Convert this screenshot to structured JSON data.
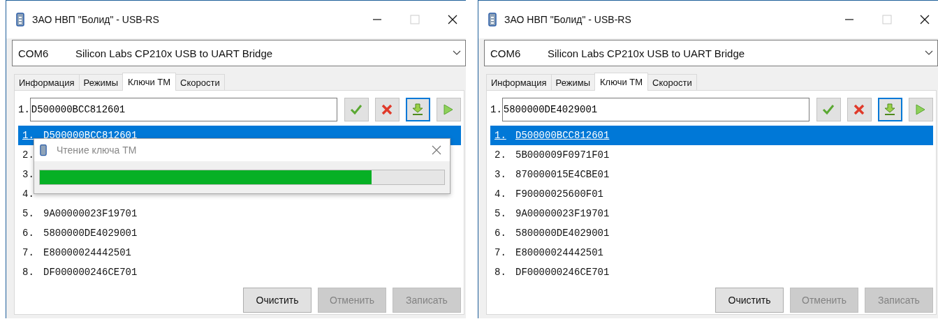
{
  "windows": [
    {
      "title": "ЗАО НВП \"Болид\" - USB-RS",
      "port": {
        "com": "COM6",
        "name": "Silicon Labs CP210x USB to UART Bridge"
      },
      "tabs": [
        {
          "label": "Информация",
          "selected": false
        },
        {
          "label": "Режимы",
          "selected": false
        },
        {
          "label": "Ключи ТМ",
          "selected": true
        },
        {
          "label": "Скорости",
          "selected": false
        }
      ],
      "key_input": {
        "prefix": "1.",
        "value": "D500000BCC812601"
      },
      "tools": [
        {
          "kind": "accept",
          "focused": false
        },
        {
          "kind": "delete",
          "focused": false
        },
        {
          "kind": "read",
          "focused": true
        },
        {
          "kind": "run",
          "focused": false
        }
      ],
      "keys": [
        {
          "number": "1.",
          "code": "D500000BCC812601",
          "selected": true
        },
        {
          "number": "2.",
          "selected": false
        },
        {
          "number": "3.",
          "selected": false
        },
        {
          "number": "4.",
          "selected": false
        },
        {
          "number": "5.",
          "code": "9A00000023F19701",
          "selected": false
        },
        {
          "number": "6.",
          "code": "5800000DE4029001",
          "selected": false
        },
        {
          "number": "7.",
          "code": "E80000024442501",
          "selected": false
        },
        {
          "number": "8.",
          "code": "DF000000246CE701",
          "selected": false
        }
      ],
      "buttons": [
        {
          "label": "Очистить",
          "disabled": false
        },
        {
          "label": "Отменить",
          "disabled": true
        },
        {
          "label": "Записать",
          "disabled": true
        }
      ],
      "dialog": {
        "title": "Чтение ключа ТМ",
        "level": 0.82
      }
    },
    {
      "title": "ЗАО НВП \"Болид\" - USB-RS",
      "port": {
        "com": "COM6",
        "name": "Silicon Labs CP210x USB to UART Bridge"
      },
      "tabs": [
        {
          "label": "Информация",
          "selected": false
        },
        {
          "label": "Режимы",
          "selected": false
        },
        {
          "label": "Ключи ТМ",
          "selected": true
        },
        {
          "label": "Скорости",
          "selected": false
        }
      ],
      "key_input": {
        "prefix": "1.",
        "value": "5800000DE4029001"
      },
      "tools": [
        {
          "kind": "accept",
          "focused": false
        },
        {
          "kind": "delete",
          "focused": false
        },
        {
          "kind": "read",
          "focused": true
        },
        {
          "kind": "run",
          "focused": false
        }
      ],
      "keys": [
        {
          "number": "1.",
          "code": "D500000BCC812601",
          "selected": true
        },
        {
          "number": "2.",
          "code": "5B000009F0971F01",
          "selected": false
        },
        {
          "number": "3.",
          "code": "870000015E4CBE01",
          "selected": false
        },
        {
          "number": "4.",
          "code": "F90000025600F01",
          "selected": false
        },
        {
          "number": "5.",
          "code": "9A00000023F19701",
          "selected": false
        },
        {
          "number": "6.",
          "code": "5800000DE4029001",
          "selected": false
        },
        {
          "number": "7.",
          "code": "E80000024442501",
          "selected": false
        },
        {
          "number": "8.",
          "code": "DF000000246CE701",
          "selected": false
        }
      ],
      "buttons": [
        {
          "label": "Очистить",
          "disabled": false
        },
        {
          "label": "Отменить",
          "disabled": true
        },
        {
          "label": "Записать",
          "disabled": true
        }
      ]
    }
  ]
}
